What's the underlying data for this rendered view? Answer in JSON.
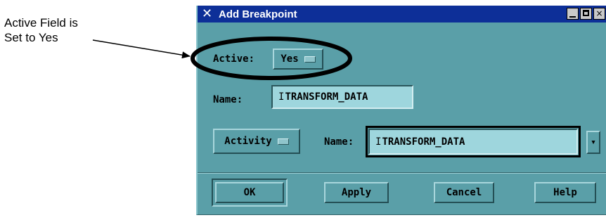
{
  "callout": {
    "line1": "Active Field is",
    "line2": "Set to Yes"
  },
  "window": {
    "title": "Add Breakpoint",
    "icon": "x-window-icon",
    "controls": {
      "minimize": "minimize-icon",
      "maximize": "maximize-icon",
      "close": "×"
    }
  },
  "form": {
    "active_label": "Active:",
    "active_value": "Yes",
    "name_label": "Name:",
    "name_value": "TRANSFORM_DATA",
    "type_value": "Activity",
    "activity_name_label": "Name:",
    "activity_name_value": "TRANSFORM_DATA",
    "dropdown_glyph": "▾"
  },
  "buttons": {
    "ok": "OK",
    "apply": "Apply",
    "cancel": "Cancel",
    "help": "Help"
  },
  "colors": {
    "dialog_bg": "#5a9fa8",
    "field_bg": "#9ed6dd",
    "titlebar": "#0d2f98"
  }
}
